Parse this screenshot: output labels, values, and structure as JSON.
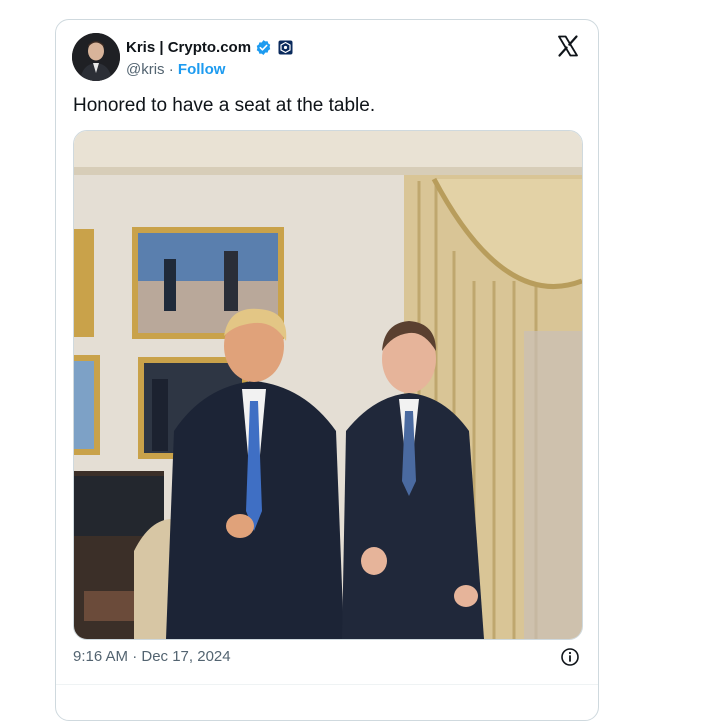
{
  "author": {
    "display_name": "Kris | Crypto.com",
    "handle": "@kris",
    "separator": " · ",
    "follow_label": "Follow"
  },
  "tweet": {
    "text": "Honored to have a seat at the table.",
    "timestamp": "9:16 AM · Dec 17, 2024"
  },
  "icons": {
    "verified": "verified-badge-icon",
    "affiliate": "affiliate-badge-icon",
    "platform": "x-logo-icon",
    "info": "info-icon"
  },
  "colors": {
    "accent": "#1d9bf0",
    "text": "#0f1419",
    "muted": "#536471",
    "border": "#cfd9de"
  }
}
